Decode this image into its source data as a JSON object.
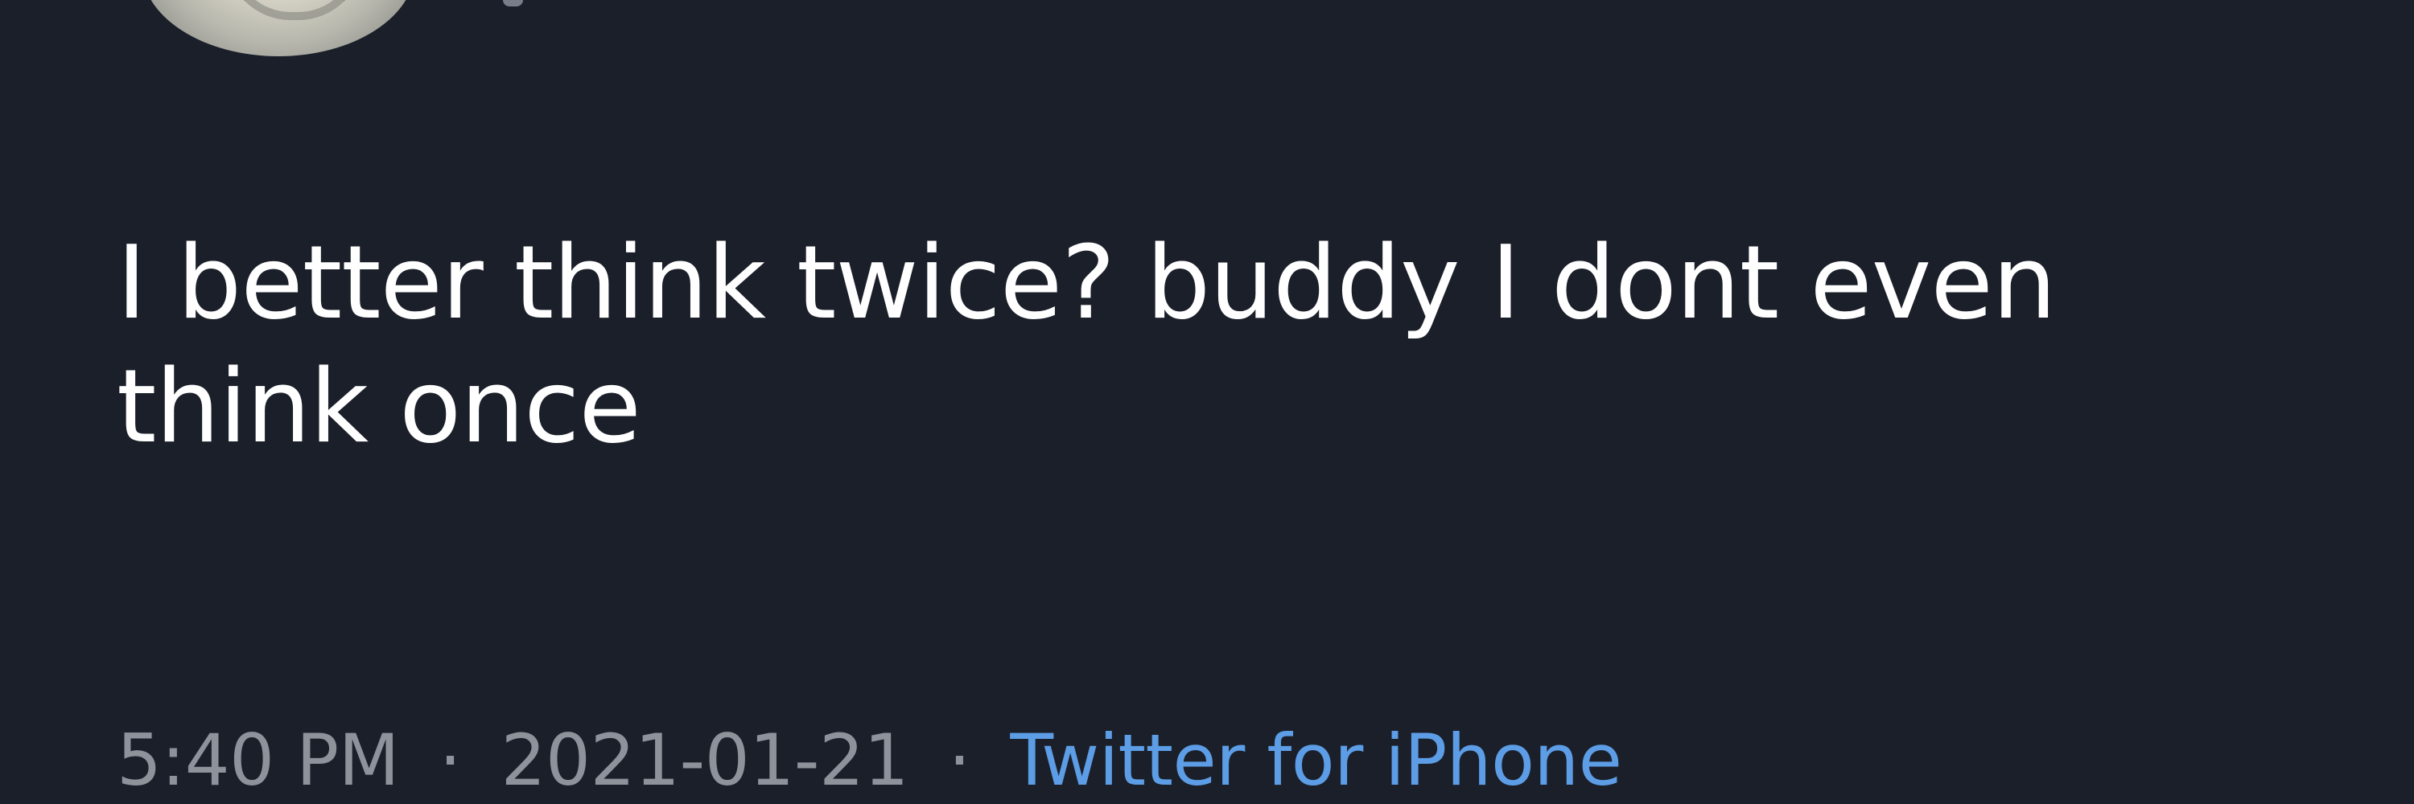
{
  "tweet": {
    "text": "I better think twice? buddy I dont even\nthink once",
    "time": "5:40 PM",
    "date": "2021-01-21",
    "separator": "·",
    "source": "Twitter for iPhone"
  },
  "colors": {
    "background": "#1b1f2a",
    "text": "#ffffff",
    "muted": "#8d929b",
    "link": "#5c9de6"
  },
  "icons": {
    "avatar": "profile-avatar"
  }
}
